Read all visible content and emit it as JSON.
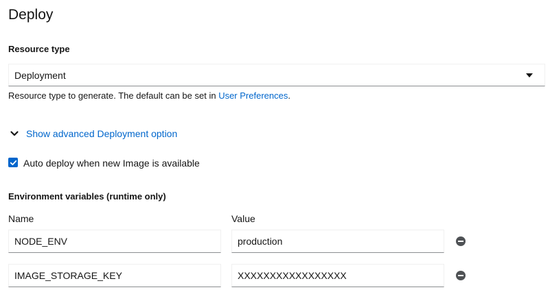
{
  "page": {
    "title": "Deploy"
  },
  "resource_type": {
    "label": "Resource type",
    "selected": "Deployment",
    "helper_prefix": "Resource type to generate. The default can be set in ",
    "helper_link": "User Preferences",
    "helper_suffix": "."
  },
  "advanced": {
    "toggle_label": "Show advanced Deployment option"
  },
  "auto_deploy": {
    "label": "Auto deploy when new Image is available",
    "checked": true
  },
  "env": {
    "section_label": "Environment variables (runtime only)",
    "name_header": "Name",
    "value_header": "Value",
    "rows": [
      {
        "name": "NODE_ENV",
        "value": "production"
      },
      {
        "name": "IMAGE_STORAGE_KEY",
        "value": "XXXXXXXXXXXXXXXXX"
      }
    ]
  },
  "colors": {
    "accent": "#0066cc",
    "text": "#151515",
    "icon": "#4f5255"
  },
  "icons": {
    "select_caret": "caret-down-icon",
    "toggle": "chevron-down-icon",
    "checkbox": "checkmark-icon",
    "remove": "minus-circle-icon"
  }
}
